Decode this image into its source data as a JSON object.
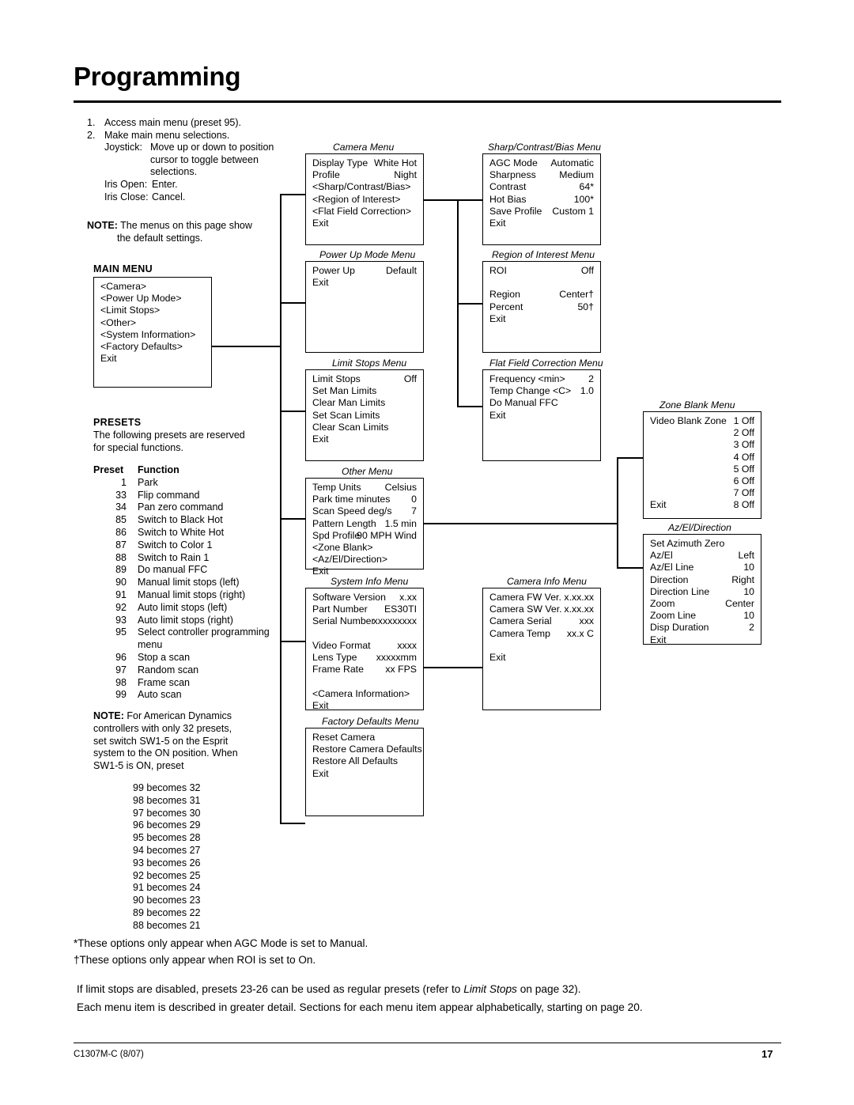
{
  "page": {
    "title": "Programming",
    "footer_left": "C1307M-C (8/07)",
    "footer_right": "17"
  },
  "intro": {
    "step1_num": "1.",
    "step1": "Access main menu (preset 95).",
    "step2_num": "2.",
    "step2": "Make main menu selections.",
    "joystick_label": "Joystick:",
    "joystick_text1": "Move up or down to position",
    "joystick_text2": "cursor to toggle between",
    "joystick_text3": "selections.",
    "iris_open_label": "Iris Open:",
    "iris_open_text": "Enter.",
    "iris_close_label": "Iris Close:",
    "iris_close_text": "Cancel.",
    "note_label": "NOTE:",
    "note_text1": "The menus on this page show",
    "note_text2": "the default settings."
  },
  "main_menu": {
    "label": "MAIN MENU",
    "items": [
      "<Camera>",
      "<Power Up Mode>",
      "<Limit Stops>",
      "<Other>",
      "<System Information>",
      "<Factory Defaults>",
      "Exit"
    ]
  },
  "presets": {
    "heading": "PRESETS",
    "intro1": "The following presets are reserved",
    "intro2": "for special functions.",
    "col1": "Preset",
    "col2": "Function",
    "rows": [
      [
        "1",
        "Park"
      ],
      [
        "33",
        "Flip command"
      ],
      [
        "34",
        "Pan zero command"
      ],
      [
        "85",
        "Switch to Black Hot"
      ],
      [
        "86",
        "Switch to White Hot"
      ],
      [
        "87",
        "Switch to Color 1"
      ],
      [
        "88",
        "Switch to Rain 1"
      ],
      [
        "89",
        "Do manual FFC"
      ],
      [
        "90",
        "Manual limit stops (left)"
      ],
      [
        "91",
        "Manual limit stops (right)"
      ],
      [
        "92",
        "Auto limit stops (left)"
      ],
      [
        "93",
        "Auto limit stops (right)"
      ],
      [
        "95",
        "Select controller programming"
      ],
      [
        "",
        "menu"
      ],
      [
        "96",
        "Stop a scan"
      ],
      [
        "97",
        "Random scan"
      ],
      [
        "98",
        "Frame scan"
      ],
      [
        "99",
        "Auto scan"
      ]
    ],
    "note_label": "NOTE:",
    "note_lines": [
      "For American Dynamics",
      "controllers with only 32 presets,",
      "set switch SW1-5 on the Esprit",
      "system to the ON position. When",
      "SW1-5 is ON, preset"
    ],
    "becomes": [
      "99 becomes 32",
      "98 becomes 31",
      "97 becomes 30",
      "96 becomes 29",
      "95 becomes 28",
      "94 becomes 27",
      "93 becomes 26",
      "92 becomes 25",
      "91 becomes 24",
      "90 becomes 23",
      "89 becomes 22",
      "88 becomes 21"
    ]
  },
  "menus": {
    "camera": {
      "title": "Camera Menu",
      "rows": [
        {
          "label": "Display Type",
          "value": "White Hot"
        },
        {
          "label": "Profile",
          "value": "Night"
        },
        {
          "label": "<Sharp/Contrast/Bias>",
          "value": ""
        },
        {
          "label": "<Region of Interest>",
          "value": ""
        },
        {
          "label": "<Flat Field Correction>",
          "value": ""
        },
        {
          "label": "Exit",
          "value": ""
        }
      ]
    },
    "sharp": {
      "title": "Sharp/Contrast/Bias Menu",
      "rows": [
        {
          "label": "AGC Mode",
          "value": "Automatic"
        },
        {
          "label": "Sharpness",
          "value": "Medium"
        },
        {
          "label": "Contrast",
          "value": "64*"
        },
        {
          "label": "Hot Bias",
          "value": "100*"
        },
        {
          "label": "Save Profile",
          "value": "Custom 1"
        },
        {
          "label": "Exit",
          "value": ""
        }
      ]
    },
    "powerup": {
      "title": "Power Up Mode Menu",
      "rows": [
        {
          "label": "Power Up",
          "value": "Default"
        },
        {
          "label": "Exit",
          "value": ""
        }
      ]
    },
    "roi": {
      "title": "Region of Interest Menu",
      "rows": [
        {
          "label": "ROI",
          "value": "Off"
        },
        {
          "label": "",
          "value": ""
        },
        {
          "label": "Region",
          "value": "Center†"
        },
        {
          "label": "Percent",
          "value": "50†"
        },
        {
          "label": "Exit",
          "value": ""
        }
      ]
    },
    "limit": {
      "title": "Limit Stops Menu",
      "rows": [
        {
          "label": "Limit Stops",
          "value": "Off"
        },
        {
          "label": "Set Man Limits",
          "value": ""
        },
        {
          "label": "Clear Man Limits",
          "value": ""
        },
        {
          "label": "Set Scan Limits",
          "value": ""
        },
        {
          "label": "Clear Scan Limits",
          "value": ""
        },
        {
          "label": "Exit",
          "value": ""
        }
      ]
    },
    "ffc": {
      "title": "Flat Field Correction Menu",
      "rows": [
        {
          "label": "Frequency <min>",
          "value": "2"
        },
        {
          "label": "Temp Change <C>",
          "value": "1.0"
        },
        {
          "label": "Do Manual FFC",
          "value": ""
        },
        {
          "label": "Exit",
          "value": ""
        }
      ]
    },
    "zoneblank": {
      "title": "Zone Blank Menu",
      "rows": [
        {
          "label": "Video Blank Zone",
          "value": "1 Off"
        },
        {
          "label": "",
          "value": "2 Off"
        },
        {
          "label": "",
          "value": "3 Off"
        },
        {
          "label": "",
          "value": "4 Off"
        },
        {
          "label": "",
          "value": "5 Off"
        },
        {
          "label": "",
          "value": "6 Off"
        },
        {
          "label": "",
          "value": "7 Off"
        },
        {
          "label": "",
          "value": "8 Off"
        },
        {
          "label": "Exit",
          "value": ""
        }
      ]
    },
    "other": {
      "title": "Other Menu",
      "rows": [
        {
          "label": "Temp Units",
          "value": "Celsius"
        },
        {
          "label": "Park time minutes",
          "value": "0"
        },
        {
          "label": "Scan Speed deg/s",
          "value": "7"
        },
        {
          "label": "Pattern Length",
          "value": "1.5 min"
        },
        {
          "label": "Spd Profile",
          "value": "90 MPH Wind"
        },
        {
          "label": "<Zone Blank>",
          "value": ""
        },
        {
          "label": "<Az/El/Direction>",
          "value": ""
        },
        {
          "label": "Exit",
          "value": ""
        }
      ]
    },
    "azel": {
      "title": "Az/El/Direction",
      "rows": [
        {
          "label": "Set Azimuth Zero",
          "value": ""
        },
        {
          "label": "Az/El",
          "value": "Left"
        },
        {
          "label": "Az/El Line",
          "value": "10"
        },
        {
          "label": "Direction",
          "value": "Right"
        },
        {
          "label": "Direction Line",
          "value": "10"
        },
        {
          "label": "Zoom",
          "value": "Center"
        },
        {
          "label": "Zoom Line",
          "value": "10"
        },
        {
          "label": "Disp Duration",
          "value": "2"
        },
        {
          "label": "Exit",
          "value": ""
        }
      ]
    },
    "sysinfo": {
      "title": "System Info Menu",
      "rows": [
        {
          "label": "Software Version",
          "value": "x.xx"
        },
        {
          "label": "Part Number",
          "value": "ES30TI"
        },
        {
          "label": "Serial Number",
          "value": "xxxxxxxxx"
        },
        {
          "label": "",
          "value": ""
        },
        {
          "label": "Video Format",
          "value": "xxxx"
        },
        {
          "label": "Lens Type",
          "value": "xxxxxmm"
        },
        {
          "label": "Frame Rate",
          "value": "xx FPS"
        },
        {
          "label": "",
          "value": ""
        },
        {
          "label": "<Camera Information>",
          "value": ""
        },
        {
          "label": "Exit",
          "value": ""
        }
      ]
    },
    "caminfo": {
      "title": "Camera Info Menu",
      "rows": [
        {
          "label": "Camera FW Ver.",
          "value": "x.xx.xx"
        },
        {
          "label": "Camera SW Ver.",
          "value": "x.xx.xx"
        },
        {
          "label": "Camera Serial",
          "value": "xxx"
        },
        {
          "label": "Camera Temp",
          "value": "xx.x C"
        },
        {
          "label": "",
          "value": ""
        },
        {
          "label": "Exit",
          "value": ""
        }
      ]
    },
    "factory": {
      "title": "Factory Defaults Menu",
      "rows": [
        {
          "label": "Reset Camera",
          "value": ""
        },
        {
          "label": "Restore Camera Defaults",
          "value": ""
        },
        {
          "label": "Restore All Defaults",
          "value": ""
        },
        {
          "label": "Exit",
          "value": ""
        }
      ]
    }
  },
  "footnotes": {
    "fn1": "*These options only appear when AGC Mode is set to Manual.",
    "fn2": "†These options only appear when ROI is set to On.",
    "para1_a": "If limit stops are disabled, presets 23-26 can be used as regular presets (refer to ",
    "para1_i": "Limit Stops",
    "para1_b": " on page 32).",
    "para2": "Each menu item is described in greater detail. Sections for each menu item appear alphabetically, starting on page 20."
  }
}
